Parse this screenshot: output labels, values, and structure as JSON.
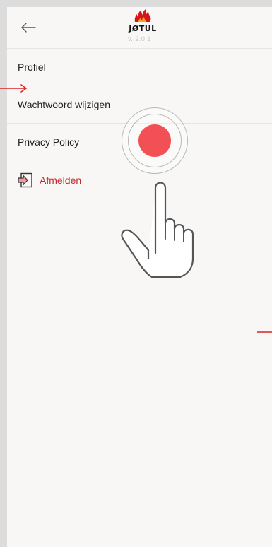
{
  "header": {
    "back_icon": "arrow-left-icon",
    "logo_icon": "flame-logo-icon",
    "logo_text": "JØTUL",
    "version": "v. 2.0.1"
  },
  "menu": {
    "items": [
      {
        "label": "Profiel"
      },
      {
        "label": "Wachtwoord wijzigen"
      },
      {
        "label": "Privacy Policy"
      }
    ]
  },
  "logout": {
    "icon": "sign-out-icon",
    "label": "Afmelden",
    "color": "#c62a2a"
  },
  "overlay": {
    "tap_indicator_color": "#f25055",
    "hand_icon": "pointing-hand-icon",
    "annotation_arrow_color": "#e02020"
  }
}
